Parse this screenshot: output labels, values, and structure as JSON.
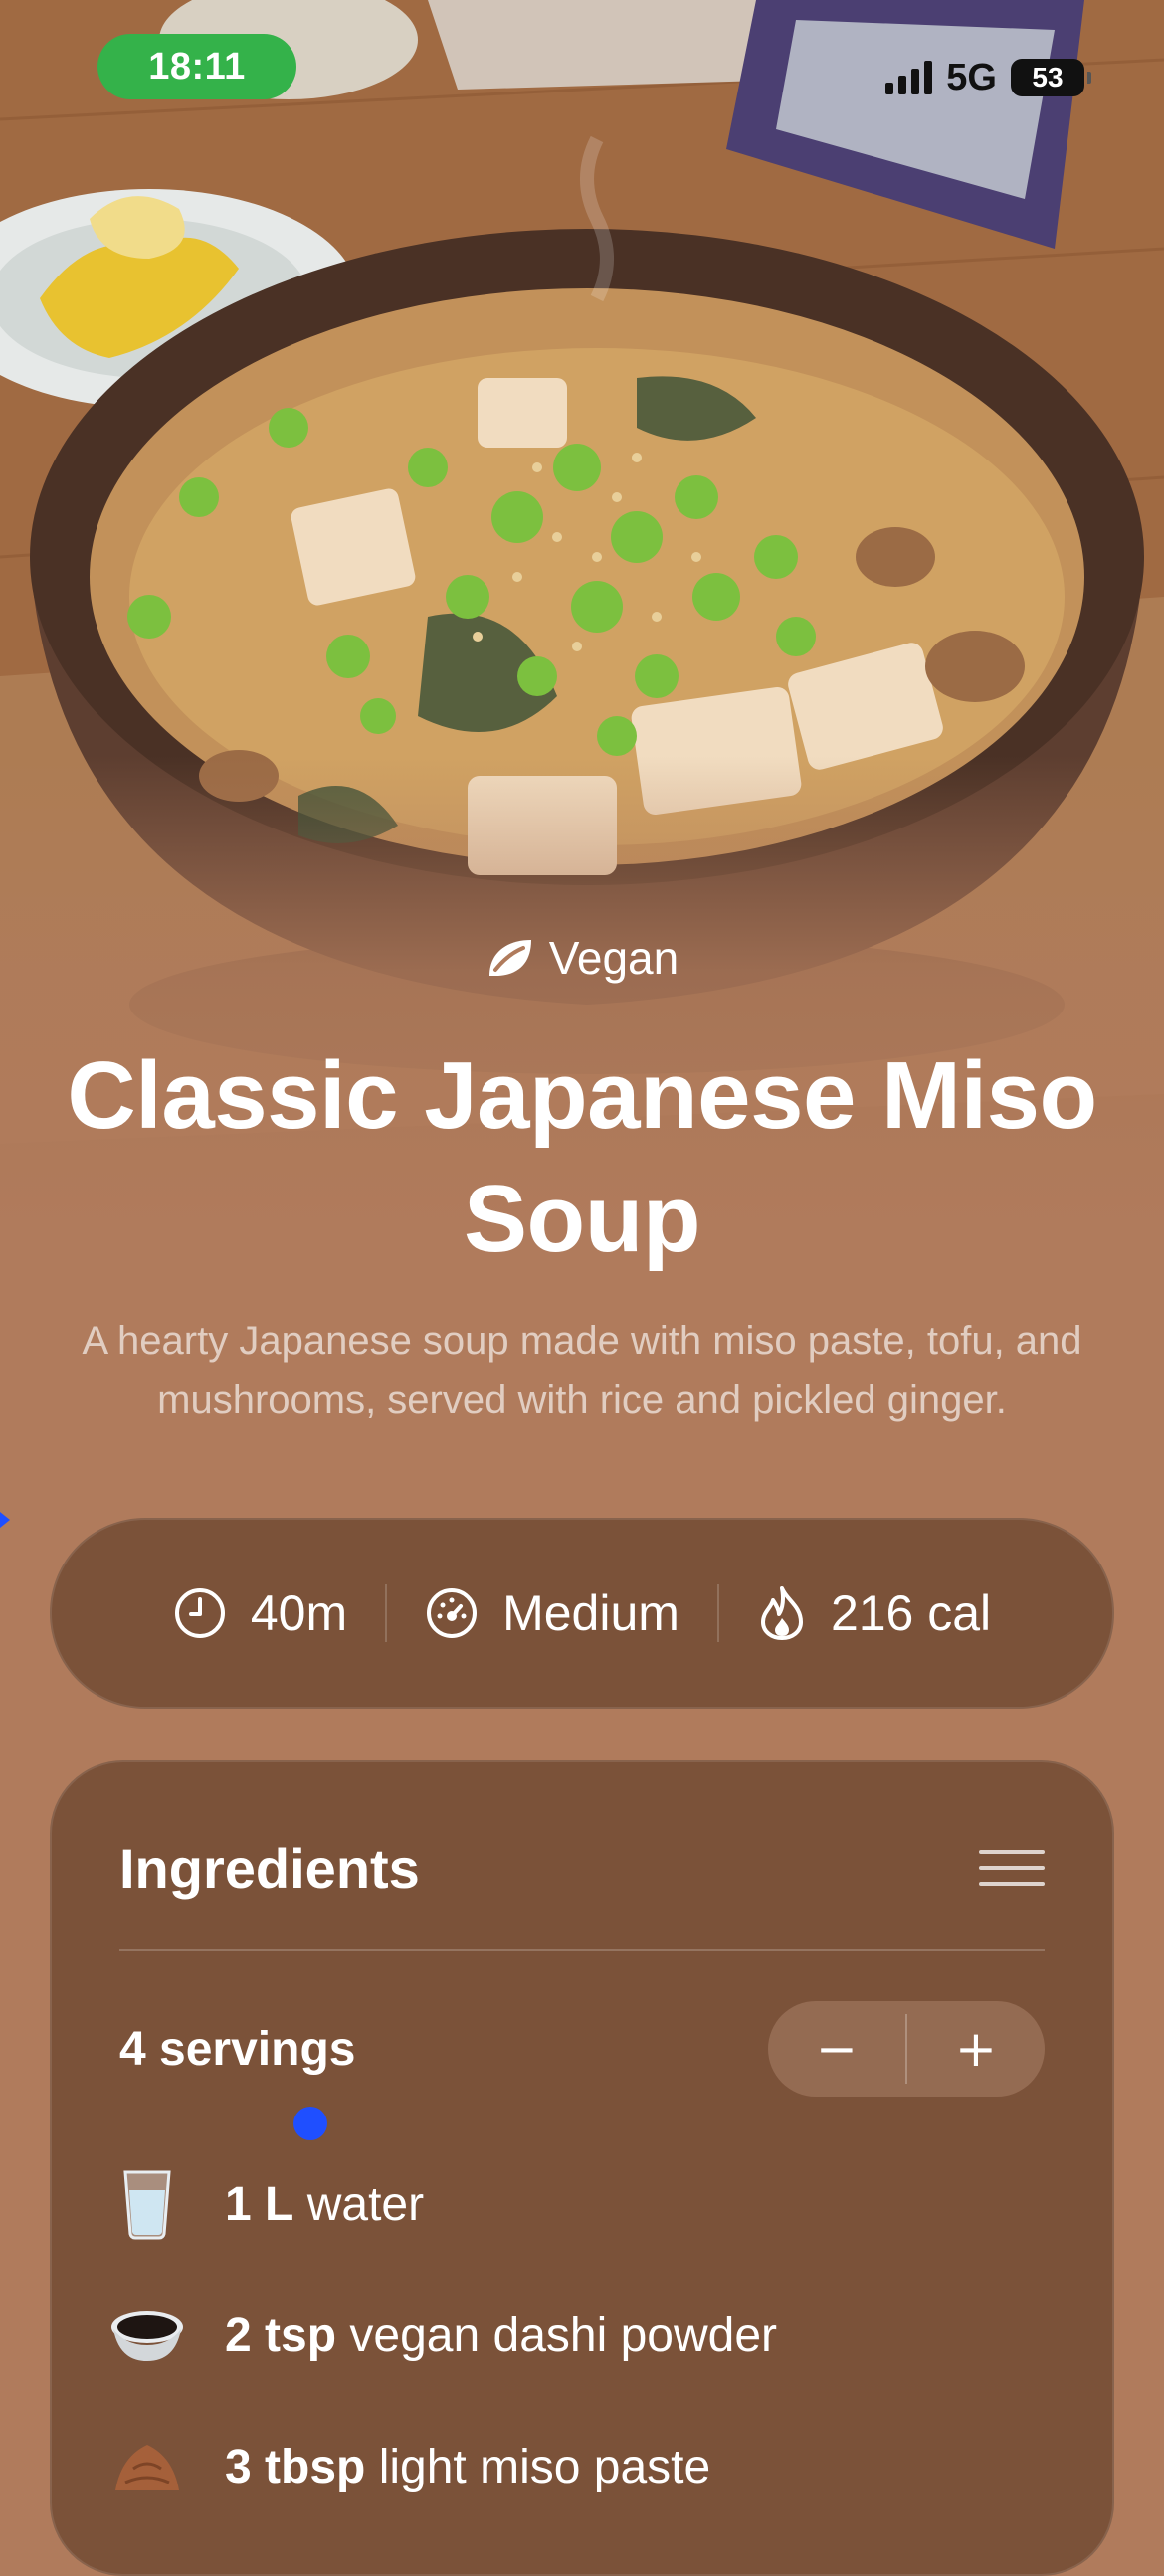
{
  "status_bar": {
    "time": "18:11",
    "network": "5G",
    "battery": "53"
  },
  "recipe": {
    "tag": "Vegan",
    "title": "Classic Japanese Miso Soup",
    "description": "A hearty Japanese soup made with miso paste, tofu, and mushrooms, served with rice and pickled ginger."
  },
  "stats": [
    {
      "icon": "clock-icon",
      "value": "40m"
    },
    {
      "icon": "gauge-icon",
      "value": "Medium"
    },
    {
      "icon": "flame-icon",
      "value": "216 cal"
    }
  ],
  "ingredients_card": {
    "title": "Ingredients",
    "servings": "4 servings",
    "decrement_label": "−",
    "increment_label": "+",
    "items": [
      {
        "icon": "water-glass-icon",
        "amount": "1 L",
        "name": "water"
      },
      {
        "icon": "dashi-bowl-icon",
        "amount": "2 tsp",
        "name": "vegan dashi powder"
      },
      {
        "icon": "miso-paste-icon",
        "amount": "3 tbsp",
        "name": "light miso paste"
      }
    ]
  },
  "colors": {
    "background": "#b07b5c",
    "card": "#7b5239",
    "status_pill": "#34b24a",
    "touch_indicator": "#1f4fff"
  }
}
